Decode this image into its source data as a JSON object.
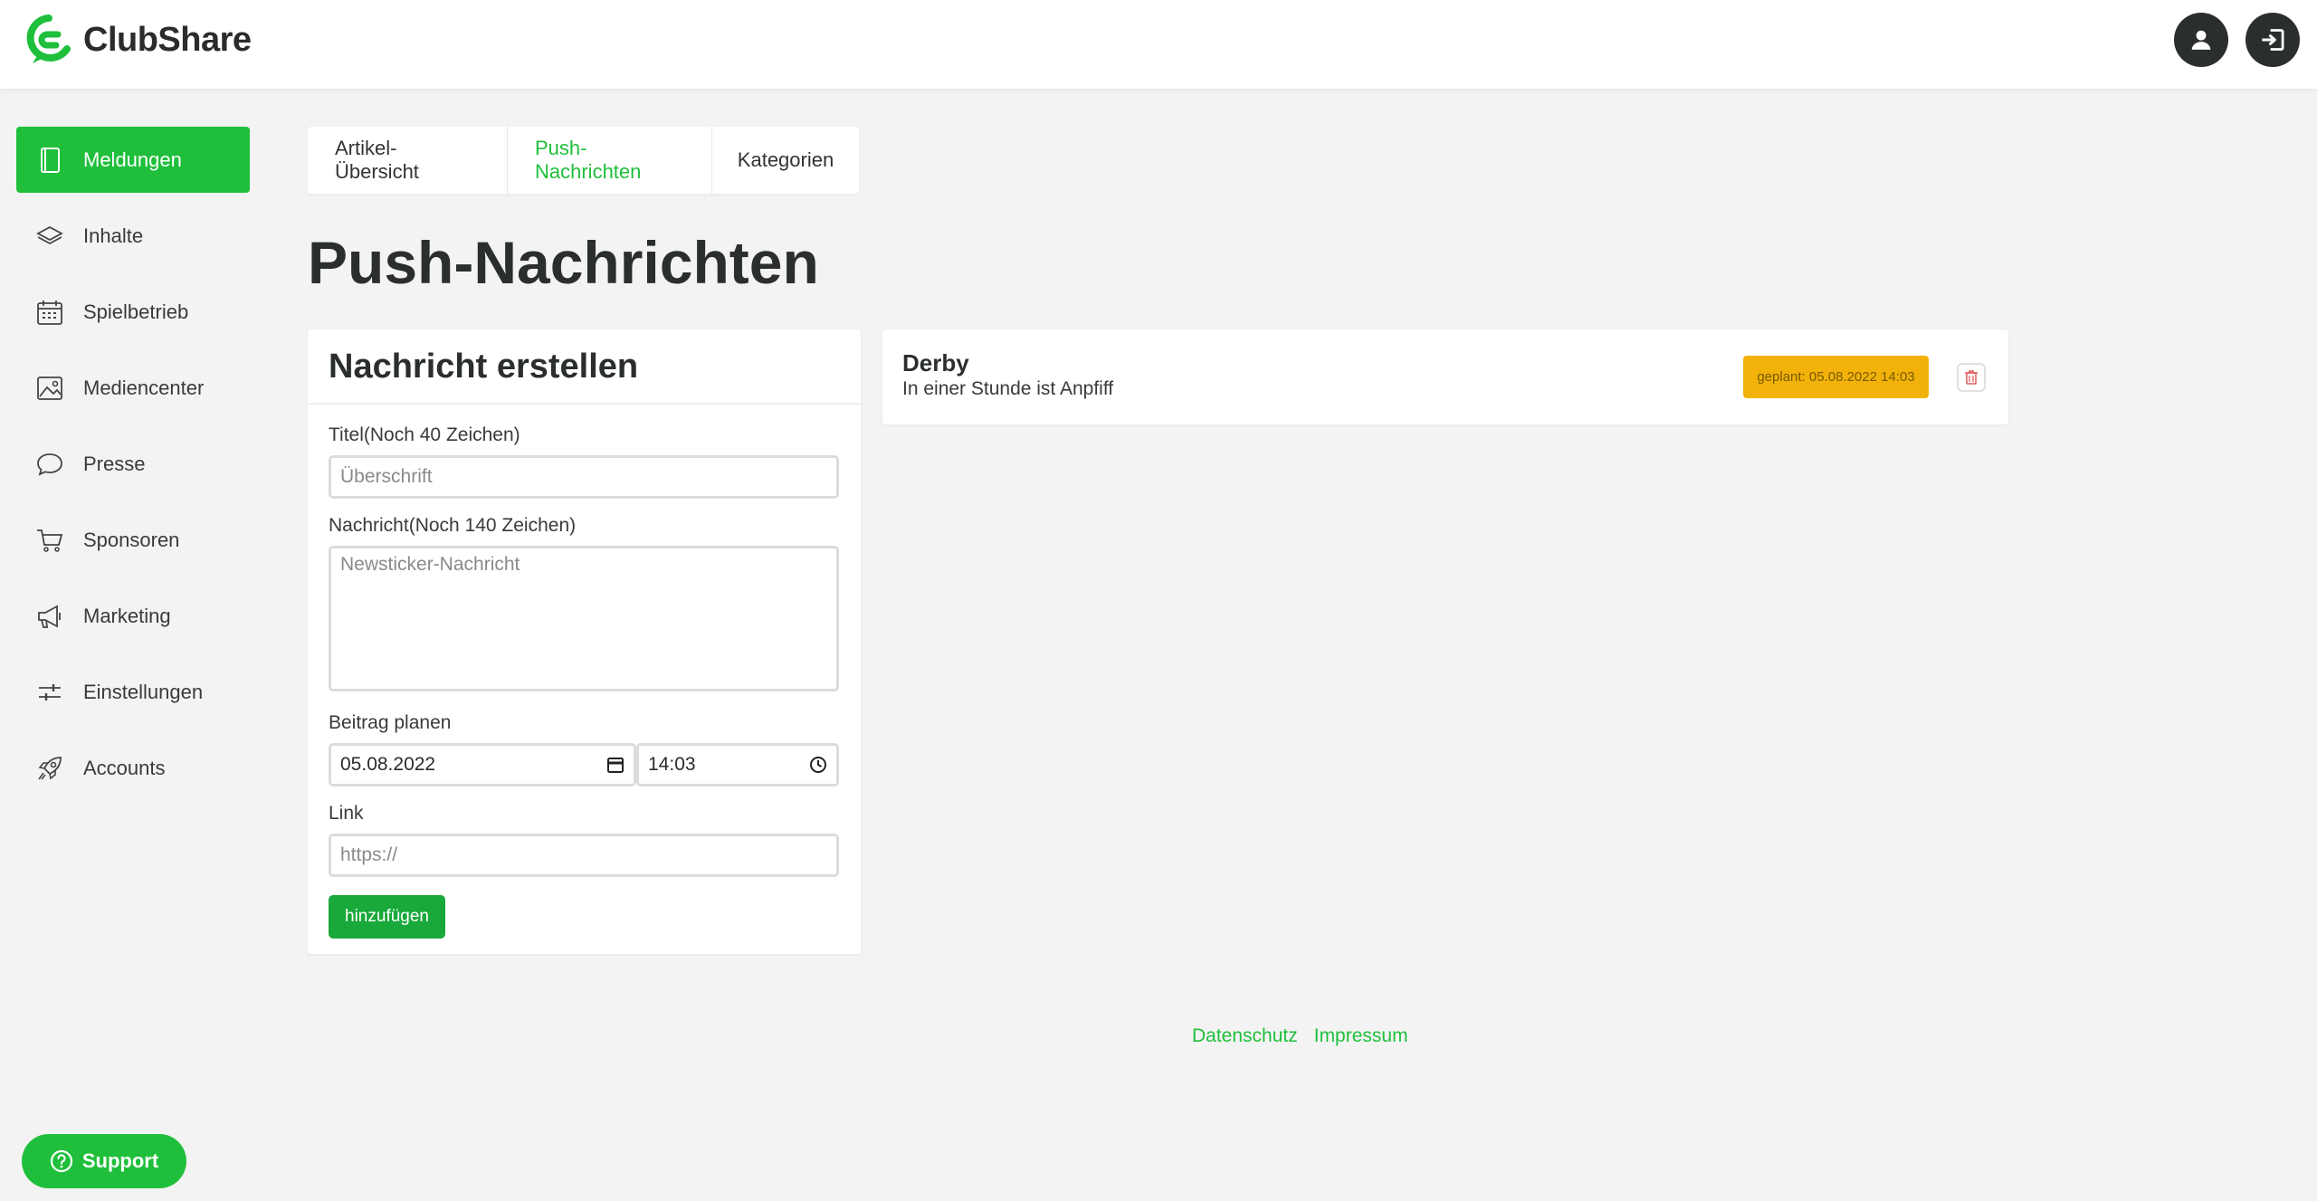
{
  "app": {
    "name": "ClubShare"
  },
  "header": {
    "user_icon": "user-icon",
    "logout_icon": "logout-icon"
  },
  "sidebar": {
    "items": [
      {
        "label": "Meldungen",
        "icon": "book-icon",
        "active": true
      },
      {
        "label": "Inhalte",
        "icon": "layers-icon",
        "active": false
      },
      {
        "label": "Spielbetrieb",
        "icon": "calendar-icon",
        "active": false
      },
      {
        "label": "Mediencenter",
        "icon": "image-icon",
        "active": false
      },
      {
        "label": "Presse",
        "icon": "chat-bubble-icon",
        "active": false
      },
      {
        "label": "Sponsoren",
        "icon": "cart-icon",
        "active": false
      },
      {
        "label": "Marketing",
        "icon": "megaphone-icon",
        "active": false
      },
      {
        "label": "Einstellungen",
        "icon": "sliders-icon",
        "active": false
      },
      {
        "label": "Accounts",
        "icon": "rocket-icon",
        "active": false
      }
    ]
  },
  "tabs": [
    {
      "label": "Artikel-Übersicht",
      "active": false
    },
    {
      "label": "Push-Nachrichten",
      "active": true
    },
    {
      "label": "Kategorien",
      "active": false
    }
  ],
  "page": {
    "title": "Push-Nachrichten"
  },
  "form": {
    "heading": "Nachricht erstellen",
    "title_label": "Titel(Noch 40 Zeichen)",
    "title_placeholder": "Überschrift",
    "message_label": "Nachricht(Noch 140 Zeichen)",
    "message_placeholder": "Newsticker-Nachricht",
    "schedule_label": "Beitrag planen",
    "date_value": "05.08.2022",
    "time_value": "14:03",
    "link_label": "Link",
    "link_placeholder": "https://",
    "submit_label": "hinzufügen"
  },
  "messages": [
    {
      "title": "Derby",
      "text": "In einer Stunde ist Anpfiff",
      "badge": "geplant: 05.08.2022 14:03"
    }
  ],
  "footer": {
    "privacy": "Datenschutz",
    "imprint": "Impressum"
  },
  "support": {
    "label": "Support"
  },
  "colors": {
    "accent": "#1fbf3b",
    "badge": "#f2b20a",
    "dark": "#2b2f2c"
  }
}
